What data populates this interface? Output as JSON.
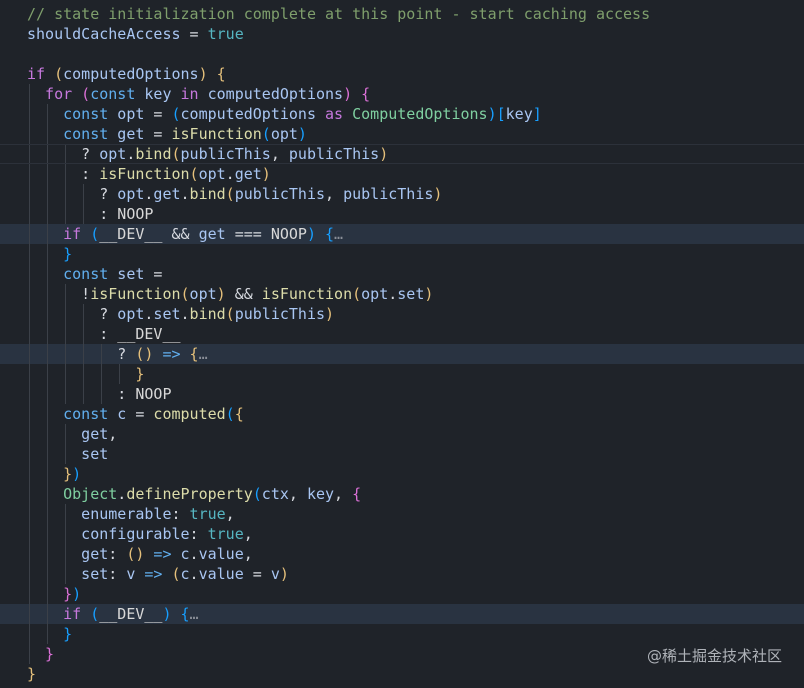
{
  "lines": [
    {
      "indent": 0,
      "tokens": [
        {
          "t": "// state initialization complete at this point - start caching access",
          "c": "comment"
        }
      ]
    },
    {
      "indent": 0,
      "tokens": [
        {
          "t": "shouldCacheAccess",
          "c": "var"
        },
        {
          "t": " = ",
          "c": "op"
        },
        {
          "t": "true",
          "c": "bool"
        }
      ]
    },
    {
      "indent": 0,
      "tokens": []
    },
    {
      "indent": 0,
      "tokens": [
        {
          "t": "if",
          "c": "ctl"
        },
        {
          "t": " (",
          "c": "p1"
        },
        {
          "t": "computedOptions",
          "c": "var"
        },
        {
          "t": ")",
          "c": "p1"
        },
        {
          "t": " ",
          "c": "op"
        },
        {
          "t": "{",
          "c": "p1"
        }
      ]
    },
    {
      "indent": 1,
      "tokens": [
        {
          "t": "for",
          "c": "ctl"
        },
        {
          "t": " (",
          "c": "p2"
        },
        {
          "t": "const",
          "c": "decl"
        },
        {
          "t": " key ",
          "c": "var"
        },
        {
          "t": "in",
          "c": "kw"
        },
        {
          "t": " computedOptions",
          "c": "var"
        },
        {
          "t": ")",
          "c": "p2"
        },
        {
          "t": " ",
          "c": "op"
        },
        {
          "t": "{",
          "c": "p2"
        }
      ]
    },
    {
      "indent": 2,
      "tokens": [
        {
          "t": "const",
          "c": "decl"
        },
        {
          "t": " opt",
          "c": "var"
        },
        {
          "t": " = ",
          "c": "op"
        },
        {
          "t": "(",
          "c": "p3"
        },
        {
          "t": "computedOptions",
          "c": "var"
        },
        {
          "t": " as ",
          "c": "kw"
        },
        {
          "t": "ComputedOptions",
          "c": "type"
        },
        {
          "t": ")",
          "c": "p3"
        },
        {
          "t": "[",
          "c": "p3"
        },
        {
          "t": "key",
          "c": "var"
        },
        {
          "t": "]",
          "c": "p3"
        }
      ]
    },
    {
      "indent": 2,
      "tokens": [
        {
          "t": "const",
          "c": "decl"
        },
        {
          "t": " get",
          "c": "var"
        },
        {
          "t": " = ",
          "c": "op"
        },
        {
          "t": "isFunction",
          "c": "fn"
        },
        {
          "t": "(",
          "c": "p3"
        },
        {
          "t": "opt",
          "c": "var"
        },
        {
          "t": ")",
          "c": "p3"
        }
      ]
    },
    {
      "indent": 3,
      "cur": true,
      "tokens": [
        {
          "t": "? ",
          "c": "op"
        },
        {
          "t": "opt",
          "c": "var"
        },
        {
          "t": ".",
          "c": "op"
        },
        {
          "t": "bind",
          "c": "fn"
        },
        {
          "t": "(",
          "c": "p1"
        },
        {
          "t": "publicThis",
          "c": "var"
        },
        {
          "t": ", ",
          "c": "op"
        },
        {
          "t": "publicThis",
          "c": "var"
        },
        {
          "t": ")",
          "c": "p1"
        }
      ]
    },
    {
      "indent": 3,
      "tokens": [
        {
          "t": ": ",
          "c": "op"
        },
        {
          "t": "isFunction",
          "c": "fn"
        },
        {
          "t": "(",
          "c": "p1"
        },
        {
          "t": "opt",
          "c": "var"
        },
        {
          "t": ".",
          "c": "op"
        },
        {
          "t": "get",
          "c": "var"
        },
        {
          "t": ")",
          "c": "p1"
        }
      ]
    },
    {
      "indent": 4,
      "tokens": [
        {
          "t": "? ",
          "c": "op"
        },
        {
          "t": "opt",
          "c": "var"
        },
        {
          "t": ".",
          "c": "op"
        },
        {
          "t": "get",
          "c": "var"
        },
        {
          "t": ".",
          "c": "op"
        },
        {
          "t": "bind",
          "c": "fn"
        },
        {
          "t": "(",
          "c": "p1"
        },
        {
          "t": "publicThis",
          "c": "var"
        },
        {
          "t": ", ",
          "c": "op"
        },
        {
          "t": "publicThis",
          "c": "var"
        },
        {
          "t": ")",
          "c": "p1"
        }
      ]
    },
    {
      "indent": 4,
      "tokens": [
        {
          "t": ": ",
          "c": "op"
        },
        {
          "t": "NOOP",
          "c": "const"
        }
      ]
    },
    {
      "indent": 2,
      "hl": true,
      "tokens": [
        {
          "t": "if",
          "c": "ctl"
        },
        {
          "t": " (",
          "c": "p3"
        },
        {
          "t": "__DEV__",
          "c": "const"
        },
        {
          "t": " && ",
          "c": "op"
        },
        {
          "t": "get",
          "c": "var"
        },
        {
          "t": " === ",
          "c": "op"
        },
        {
          "t": "NOOP",
          "c": "const"
        },
        {
          "t": ")",
          "c": "p3"
        },
        {
          "t": " ",
          "c": "op"
        },
        {
          "t": "{",
          "c": "p3"
        },
        {
          "t": "…",
          "c": "fold"
        }
      ]
    },
    {
      "indent": 2,
      "tokens": [
        {
          "t": "}",
          "c": "p3"
        }
      ]
    },
    {
      "indent": 2,
      "tokens": [
        {
          "t": "const",
          "c": "decl"
        },
        {
          "t": " set",
          "c": "var"
        },
        {
          "t": " =",
          "c": "op"
        }
      ]
    },
    {
      "indent": 3,
      "tokens": [
        {
          "t": "!",
          "c": "op"
        },
        {
          "t": "isFunction",
          "c": "fn"
        },
        {
          "t": "(",
          "c": "p1"
        },
        {
          "t": "opt",
          "c": "var"
        },
        {
          "t": ")",
          "c": "p1"
        },
        {
          "t": " && ",
          "c": "op"
        },
        {
          "t": "isFunction",
          "c": "fn"
        },
        {
          "t": "(",
          "c": "p1"
        },
        {
          "t": "opt",
          "c": "var"
        },
        {
          "t": ".",
          "c": "op"
        },
        {
          "t": "set",
          "c": "var"
        },
        {
          "t": ")",
          "c": "p1"
        }
      ]
    },
    {
      "indent": 4,
      "tokens": [
        {
          "t": "? ",
          "c": "op"
        },
        {
          "t": "opt",
          "c": "var"
        },
        {
          "t": ".",
          "c": "op"
        },
        {
          "t": "set",
          "c": "var"
        },
        {
          "t": ".",
          "c": "op"
        },
        {
          "t": "bind",
          "c": "fn"
        },
        {
          "t": "(",
          "c": "p1"
        },
        {
          "t": "publicThis",
          "c": "var"
        },
        {
          "t": ")",
          "c": "p1"
        }
      ]
    },
    {
      "indent": 4,
      "tokens": [
        {
          "t": ": ",
          "c": "op"
        },
        {
          "t": "__DEV__",
          "c": "const"
        }
      ]
    },
    {
      "indent": 5,
      "hl": true,
      "tokens": [
        {
          "t": "? ",
          "c": "op"
        },
        {
          "t": "()",
          "c": "p1"
        },
        {
          "t": " => ",
          "c": "decl"
        },
        {
          "t": "{",
          "c": "p1"
        },
        {
          "t": "…",
          "c": "fold"
        }
      ]
    },
    {
      "indent": 6,
      "tokens": [
        {
          "t": "}",
          "c": "p1"
        }
      ]
    },
    {
      "indent": 5,
      "tokens": [
        {
          "t": ": ",
          "c": "op"
        },
        {
          "t": "NOOP",
          "c": "const"
        }
      ]
    },
    {
      "indent": 2,
      "tokens": [
        {
          "t": "const",
          "c": "decl"
        },
        {
          "t": " c",
          "c": "var"
        },
        {
          "t": " = ",
          "c": "op"
        },
        {
          "t": "computed",
          "c": "fn"
        },
        {
          "t": "(",
          "c": "p3"
        },
        {
          "t": "{",
          "c": "p1"
        }
      ]
    },
    {
      "indent": 3,
      "tokens": [
        {
          "t": "get",
          "c": "var"
        },
        {
          "t": ",",
          "c": "op"
        }
      ]
    },
    {
      "indent": 3,
      "tokens": [
        {
          "t": "set",
          "c": "var"
        }
      ]
    },
    {
      "indent": 2,
      "tokens": [
        {
          "t": "}",
          "c": "p1"
        },
        {
          "t": ")",
          "c": "p3"
        }
      ]
    },
    {
      "indent": 2,
      "tokens": [
        {
          "t": "Object",
          "c": "type"
        },
        {
          "t": ".",
          "c": "op"
        },
        {
          "t": "defineProperty",
          "c": "fn"
        },
        {
          "t": "(",
          "c": "p3"
        },
        {
          "t": "ctx",
          "c": "var"
        },
        {
          "t": ", ",
          "c": "op"
        },
        {
          "t": "key",
          "c": "var"
        },
        {
          "t": ", ",
          "c": "op"
        },
        {
          "t": "{",
          "c": "p2"
        }
      ]
    },
    {
      "indent": 3,
      "tokens": [
        {
          "t": "enumerable",
          "c": "var"
        },
        {
          "t": ": ",
          "c": "op"
        },
        {
          "t": "true",
          "c": "bool"
        },
        {
          "t": ",",
          "c": "op"
        }
      ]
    },
    {
      "indent": 3,
      "tokens": [
        {
          "t": "configurable",
          "c": "var"
        },
        {
          "t": ": ",
          "c": "op"
        },
        {
          "t": "true",
          "c": "bool"
        },
        {
          "t": ",",
          "c": "op"
        }
      ]
    },
    {
      "indent": 3,
      "tokens": [
        {
          "t": "get",
          "c": "var"
        },
        {
          "t": ": ",
          "c": "op"
        },
        {
          "t": "()",
          "c": "p1"
        },
        {
          "t": " => ",
          "c": "decl"
        },
        {
          "t": "c",
          "c": "var"
        },
        {
          "t": ".",
          "c": "op"
        },
        {
          "t": "value",
          "c": "var"
        },
        {
          "t": ",",
          "c": "op"
        }
      ]
    },
    {
      "indent": 3,
      "tokens": [
        {
          "t": "set",
          "c": "var"
        },
        {
          "t": ": ",
          "c": "op"
        },
        {
          "t": "v",
          "c": "var"
        },
        {
          "t": " => ",
          "c": "decl"
        },
        {
          "t": "(",
          "c": "p1"
        },
        {
          "t": "c",
          "c": "var"
        },
        {
          "t": ".",
          "c": "op"
        },
        {
          "t": "value",
          "c": "var"
        },
        {
          "t": " = ",
          "c": "op"
        },
        {
          "t": "v",
          "c": "var"
        },
        {
          "t": ")",
          "c": "p1"
        }
      ]
    },
    {
      "indent": 2,
      "tokens": [
        {
          "t": "}",
          "c": "p2"
        },
        {
          "t": ")",
          "c": "p3"
        }
      ]
    },
    {
      "indent": 2,
      "hl": true,
      "tokens": [
        {
          "t": "if",
          "c": "ctl"
        },
        {
          "t": " (",
          "c": "p3"
        },
        {
          "t": "__DEV__",
          "c": "const"
        },
        {
          "t": ")",
          "c": "p3"
        },
        {
          "t": " ",
          "c": "op"
        },
        {
          "t": "{",
          "c": "p3"
        },
        {
          "t": "…",
          "c": "fold"
        }
      ]
    },
    {
      "indent": 2,
      "tokens": [
        {
          "t": "}",
          "c": "p3"
        }
      ]
    },
    {
      "indent": 1,
      "tokens": [
        {
          "t": "}",
          "c": "p2"
        }
      ]
    },
    {
      "indent": 0,
      "tokens": [
        {
          "t": "}",
          "c": "p1"
        }
      ]
    }
  ],
  "watermark": "@稀土掘金技术社区"
}
